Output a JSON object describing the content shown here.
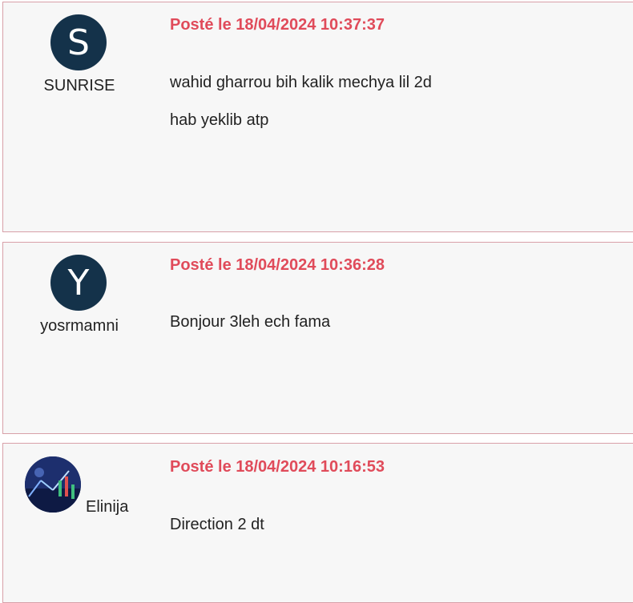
{
  "posts": [
    {
      "avatar_letter": "S",
      "username": "SUNRISE",
      "date": "Posté le 18/04/2024 10:37:37",
      "lines": [
        "wahid gharrou bih kalik mechya lil 2d",
        "hab yeklib atp"
      ]
    },
    {
      "avatar_letter": "Y",
      "username": "yosrmamni",
      "date": "Posté le 18/04/2024 10:36:28",
      "lines": [
        "Bonjour 3leh ech fama"
      ]
    },
    {
      "avatar_letter": "",
      "username": "Elinija",
      "date": "Posté le 18/04/2024 10:16:53",
      "lines": [
        "Direction 2 dt"
      ]
    }
  ],
  "colors": {
    "date": "#e04b5a",
    "border": "#d8a0a8",
    "avatar_bg": "#14324a",
    "card_bg": "#f7f7f7"
  }
}
